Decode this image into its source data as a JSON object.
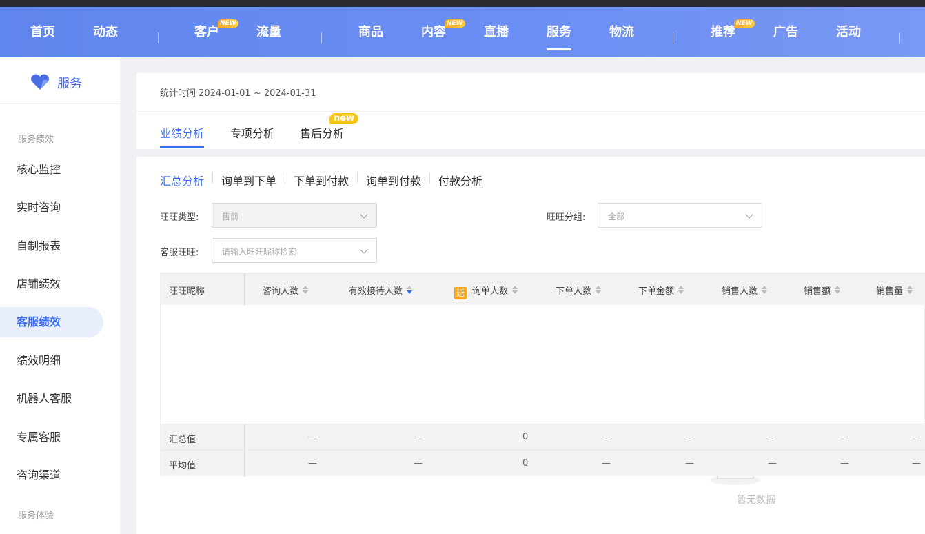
{
  "topnav": {
    "items": [
      {
        "label": "首页",
        "badge": ""
      },
      {
        "label": "动态",
        "badge": ""
      },
      {
        "label": "客户",
        "badge": "NEW"
      },
      {
        "label": "流量",
        "badge": ""
      },
      {
        "label": "商品",
        "badge": ""
      },
      {
        "label": "内容",
        "badge": "NEW"
      },
      {
        "label": "直播",
        "badge": ""
      },
      {
        "label": "服务",
        "badge": ""
      },
      {
        "label": "物流",
        "badge": ""
      },
      {
        "label": "推荐",
        "badge": "NEW"
      },
      {
        "label": "广告",
        "badge": ""
      },
      {
        "label": "活动",
        "badge": ""
      }
    ],
    "active": "服务"
  },
  "sidebar": {
    "brand": "服务",
    "group1": "服务绩效",
    "items": [
      {
        "label": "核心监控"
      },
      {
        "label": "实时咨询"
      },
      {
        "label": "自制报表"
      },
      {
        "label": "店铺绩效"
      },
      {
        "label": "客服绩效"
      },
      {
        "label": "绩效明细"
      },
      {
        "label": "机器人客服"
      },
      {
        "label": "专属客服"
      },
      {
        "label": "咨询渠道"
      }
    ],
    "active": "客服绩效",
    "group2": "服务体验"
  },
  "header": {
    "stat_time": "统计时间 2024-01-01 ~ 2024-01-31",
    "tabs": [
      {
        "label": "业绩分析"
      },
      {
        "label": "专项分析"
      },
      {
        "label": "售后分析"
      }
    ],
    "new_badge": "new"
  },
  "subtabs": [
    {
      "label": "汇总分析"
    },
    {
      "label": "询单到下单"
    },
    {
      "label": "下单到付款"
    },
    {
      "label": "询单到付款"
    },
    {
      "label": "付款分析"
    }
  ],
  "filters": {
    "type_label": "旺旺类型:",
    "type_value": "售前",
    "group_label": "旺旺分组:",
    "group_value": "全部",
    "agent_label": "客服旺旺:",
    "agent_placeholder": "请输入旺旺昵称检索"
  },
  "table": {
    "columns": [
      "旺旺昵称",
      "咨询人数",
      "有效接待人数",
      "询单人数",
      "下单人数",
      "下单金额",
      "销售人数",
      "销售额",
      "销售量"
    ],
    "yan_badge": "延",
    "empty_text": "暂无数据",
    "summary": {
      "label": "汇总值",
      "values": [
        "—",
        "—",
        "0",
        "—",
        "—",
        "—",
        "—",
        "—"
      ]
    },
    "average": {
      "label": "平均值",
      "values": [
        "—",
        "—",
        "0",
        "—",
        "—",
        "—",
        "—",
        "—"
      ]
    }
  },
  "colors": {
    "accent": "#3d6ef0",
    "nav_bg": "#6a8ef3",
    "badge": "#f5a623"
  }
}
